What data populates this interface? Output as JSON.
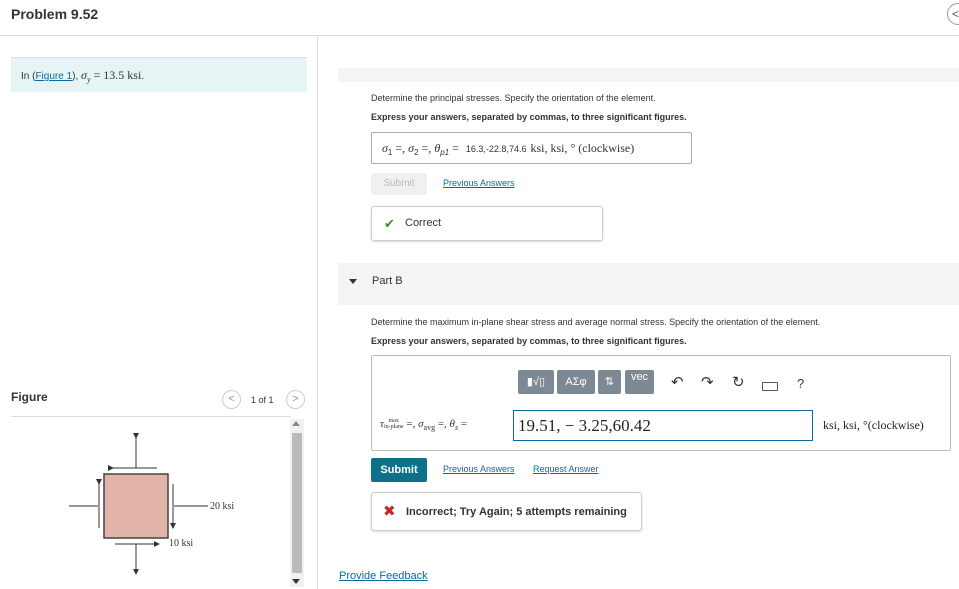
{
  "header": {
    "title": "Problem 9.52",
    "nav_glyph": "<"
  },
  "statement": {
    "prefix": "In (",
    "link": "Figure 1",
    "suffix": "), ",
    "sigma_sym": "σ",
    "sigma_sub": "y",
    "equals": " = ",
    "value": "13.5 ksi",
    "period": "."
  },
  "figure": {
    "label": "Figure",
    "counter": "1 of 1",
    "prev": "<",
    "next": ">",
    "label_20": "20 ksi",
    "label_10": "10 ksi",
    "element_fill": "#e2b3a8"
  },
  "part_a": {
    "instruction": "Determine the principal stresses. Specify the orientation of the element.",
    "express": "Express your answers, separated by commas, to three significant figures.",
    "sigma1": "σ",
    "sub1": "1",
    "sigma2": "σ",
    "sub2": "2",
    "theta": "θ",
    "subp": "p1",
    "sep": " =, ",
    "eq": " = ",
    "answer": "16.3,-22.8,74.6",
    "units": "ksi, ksi, ° (clockwise)",
    "submit": "Submit",
    "previous_answers": "Previous Answers",
    "result": "Correct",
    "check": "✔"
  },
  "part_b": {
    "title": "Part B",
    "instruction": "Determine the maximum in-plane shear stress and average normal stress. Specify the orientation of the element.",
    "express": "Express your answers, separated by commas, to three significant figures.",
    "toolbar": {
      "templates": "▮√▯",
      "greek": "ΑΣφ",
      "arrows": "⇅",
      "vec": "vec",
      "undo": "↶",
      "redo": "↷",
      "reset": "↻",
      "help": "?"
    },
    "tau": "τ",
    "tau_top": "max",
    "tau_bot": "in-plane",
    "sigma_avg": "σ",
    "avg_sub": "avg",
    "theta": "θ",
    "theta_sub": "s",
    "sep": " =, ",
    "eq": " = ",
    "answer": "19.51, − 3.25,60.42",
    "units": "ksi, ksi, °(clockwise)",
    "submit": "Submit",
    "previous_answers": "Previous Answers",
    "request_answer": "Request Answer",
    "result": "Incorrect; Try Again; 5 attempts remaining",
    "x_mark": "✖"
  },
  "footer": {
    "feedback": "Provide Feedback"
  }
}
